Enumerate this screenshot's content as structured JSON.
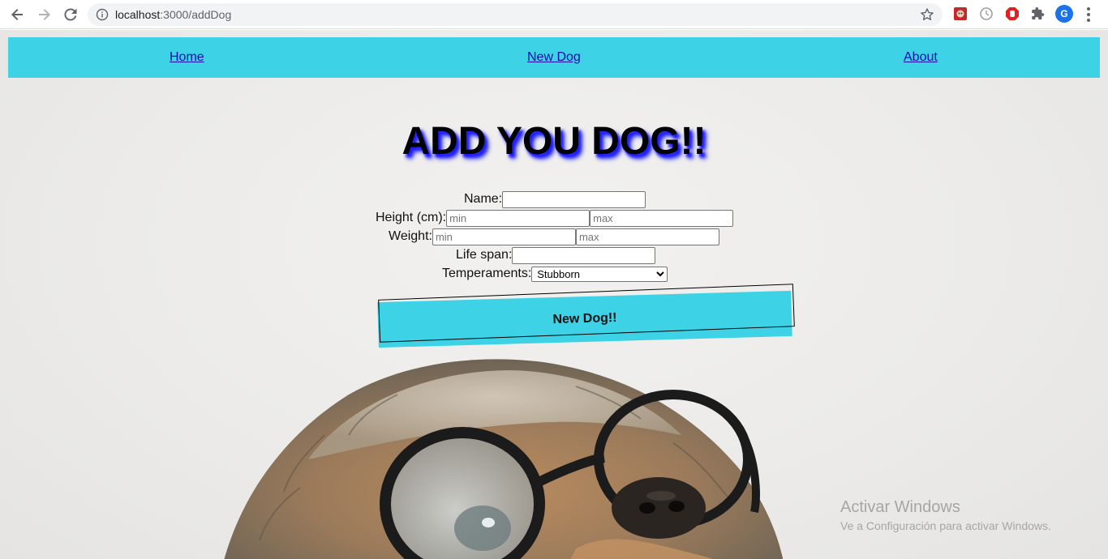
{
  "browser": {
    "url_host": "localhost",
    "url_path": ":3000/addDog",
    "avatar_letter": "G"
  },
  "nav": {
    "home": "Home",
    "new_dog": "New Dog",
    "about": "About"
  },
  "form": {
    "title": "ADD YOU DOG!!",
    "name_label": "Name:",
    "height_label": "Height (cm):",
    "weight_label": "Weight:",
    "lifespan_label": "Life span:",
    "temperaments_label": "Temperaments:",
    "min_placeholder": "min",
    "max_placeholder": "max",
    "temperament_selected": "Stubborn",
    "submit_label": "New Dog!!"
  },
  "watermark": {
    "line1": "Activar Windows",
    "line2": "Ve a Configuración para activar Windows."
  },
  "colors": {
    "accent": "#3dd2e6",
    "link": "#1a0dab",
    "title_shadow": "#1a1aff"
  }
}
